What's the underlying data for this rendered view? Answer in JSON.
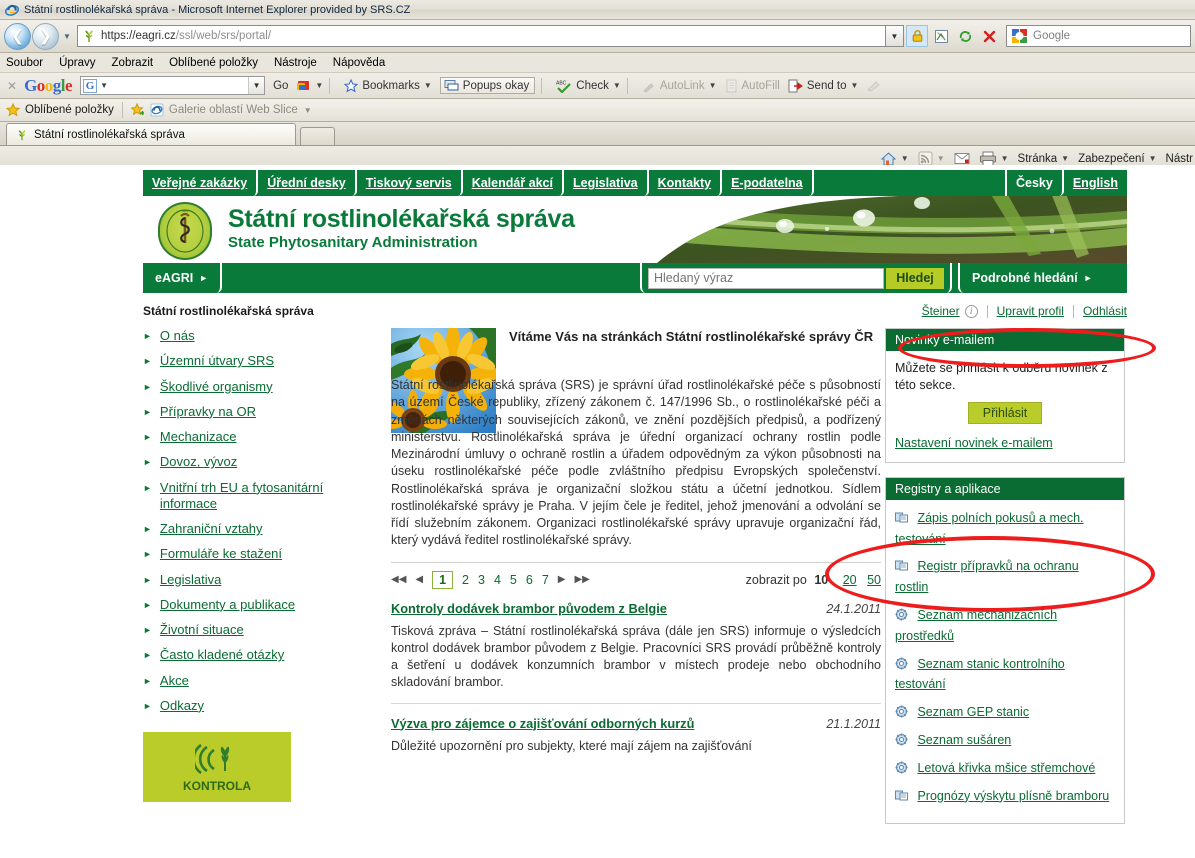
{
  "browser": {
    "title": "Státní rostlinolékařská správa - Microsoft Internet Explorer provided by SRS.CZ",
    "address": "https://eagri.cz/ssl/web/srs/portal/",
    "address_host": "https://eagri.cz",
    "address_path": "/ssl/web/srs/portal/",
    "search_placeholder": "Google",
    "menu": [
      "Soubor",
      "Úpravy",
      "Zobrazit",
      "Oblíbené položky",
      "Nástroje",
      "Nápověda"
    ],
    "google_toolbar": {
      "brand": "Google",
      "go_label": "Go",
      "bookmarks_label": "Bookmarks",
      "popups_label": "Popups okay",
      "check_label": "Check",
      "autolink_label": "AutoLink",
      "autofill_label": "AutoFill",
      "sendto_label": "Send to"
    },
    "favbar": {
      "favorites_label": "Oblíbené položky",
      "webslice_label": "Galerie oblastí Web Slice"
    },
    "tab_label": "Státní rostlinolékařská správa",
    "command_bar": [
      "Stránka",
      "Zabezpečení",
      "Nástr"
    ]
  },
  "topnav": {
    "items": [
      {
        "label": "Veřejné zakázky"
      },
      {
        "label": "Úřední desky"
      },
      {
        "label": "Tiskový servis"
      },
      {
        "label": "Kalendář akcí"
      },
      {
        "label": "Legislativa"
      },
      {
        "label": "Kontakty"
      },
      {
        "label": "E-podatelna"
      }
    ],
    "lang": [
      {
        "label": "Česky"
      },
      {
        "label": "English"
      }
    ]
  },
  "header": {
    "title_cs": "Státní rostlinolékařská správa",
    "title_en": "State Phytosanitary Administration"
  },
  "strip": {
    "eagri_label": "eAGRI",
    "search_placeholder": "Hledaný výraz",
    "search_value": "",
    "search_button": "Hledej",
    "advanced_label": "Podrobné hledání"
  },
  "crumb": {
    "path": "Státní rostlinolékařská správa",
    "user_name": "Šteiner",
    "edit_profile": "Upravit profil",
    "logout": "Odhlásit"
  },
  "sidebar": {
    "items": [
      {
        "label": "O nás"
      },
      {
        "label": "Územní útvary SRS"
      },
      {
        "label": "Škodlivé organismy"
      },
      {
        "label": "Přípravky na OR"
      },
      {
        "label": "Mechanizace"
      },
      {
        "label": "Dovoz, vývoz"
      },
      {
        "label": "Vnitřní trh EU a fytosanitární informace"
      },
      {
        "label": "Zahraniční vztahy"
      },
      {
        "label": "Formuláře ke stažení"
      },
      {
        "label": "Legislativa"
      },
      {
        "label": "Dokumenty a publikace"
      },
      {
        "label": "Životní situace"
      },
      {
        "label": "Často kladené otázky"
      },
      {
        "label": "Akce"
      },
      {
        "label": "Odkazy"
      }
    ],
    "banner_label": "KONTROLA"
  },
  "main": {
    "intro_heading": "Vítáme Vás na stránkách Státní rostlinolékařské správy ČR",
    "intro_body": "Státní rostlinolékařská správa (SRS) je správní úřad rostlinolékařské péče s působností na území České republiky, zřízený zákonem č. 147/1996 Sb., o rostlinolékařské péči a změnách některých souvisejících zákonů, ve znění pozdějších předpisů, a podřízený ministerstvu. Rostlinolékařská správa je úřední organizací ochrany rostlin podle Mezinárodní úmluvy o ochraně rostlin a úřadem odpovědným za výkon působnosti na úseku rostlinolékařské péče podle zvláštního předpisu Evropských společenství. Rostlinolékařská správa je organizační složkou státu a účetní jednotkou. Sídlem rostlinolékařské správy je Praha. V jejím čele je ředitel, jehož jmenování a odvolání se řídí služebním zákonem. Organizaci rostlinolékařské správy upravuje organizační řád, který vydává ředitel rostlinolékařské správy.",
    "pager": {
      "pages": [
        "1",
        "2",
        "3",
        "4",
        "5",
        "6",
        "7"
      ],
      "current": "1",
      "show_label": "zobrazit po",
      "per_page_current": "10",
      "per_page_options": [
        "20",
        "50"
      ]
    },
    "articles": [
      {
        "title": "Kontroly dodávek brambor původem z Belgie",
        "date": "24.1.2011",
        "body": "Tisková zpráva – Státní rostlinolékařská správa (dále jen SRS) informuje o výsledcích kontrol dodávek brambor původem z Belgie. Pracovníci SRS provádí průběžně kontroly a šetření u dodávek konzumních brambor v místech prodeje nebo obchodního skladování brambor."
      },
      {
        "title": "Výzva pro zájemce o zajišťování odborných kurzů",
        "date": "21.1.2011",
        "body": "Důležité upozornění pro subjekty, které mají zájem na zajišťování"
      }
    ]
  },
  "right": {
    "newsletter": {
      "heading": "Novinky e-mailem",
      "body": "Můžete se přihlásit k odběru novinek z této sekce.",
      "button": "Přihlásit",
      "settings_link": "Nastavení novinek e-mailem"
    },
    "registry": {
      "heading": "Registry a aplikace",
      "items": [
        {
          "label": "Zápis polních pokusů a mech. testování",
          "icon": "app-window-icon"
        },
        {
          "label": "Registr přípravků na ochranu rostlin",
          "icon": "app-window-icon"
        },
        {
          "label": "Seznam mechanizačních prostředků",
          "icon": "gear-icon"
        },
        {
          "label": "Seznam stanic kontrolního testování",
          "icon": "gear-icon"
        },
        {
          "label": "Seznam GEP stanic",
          "icon": "gear-icon"
        },
        {
          "label": "Seznam sušáren",
          "icon": "gear-icon"
        },
        {
          "label": "Letová křivka mšice střemchové",
          "icon": "gear-icon"
        },
        {
          "label": "Prognózy výskytu plísně bramboru",
          "icon": "app-window-icon"
        }
      ]
    }
  },
  "colors": {
    "brand_green": "#0a7a3a",
    "link_green": "#0a6b33",
    "lime": "#b9cc2a",
    "annotation_red": "#ee1c1c"
  }
}
